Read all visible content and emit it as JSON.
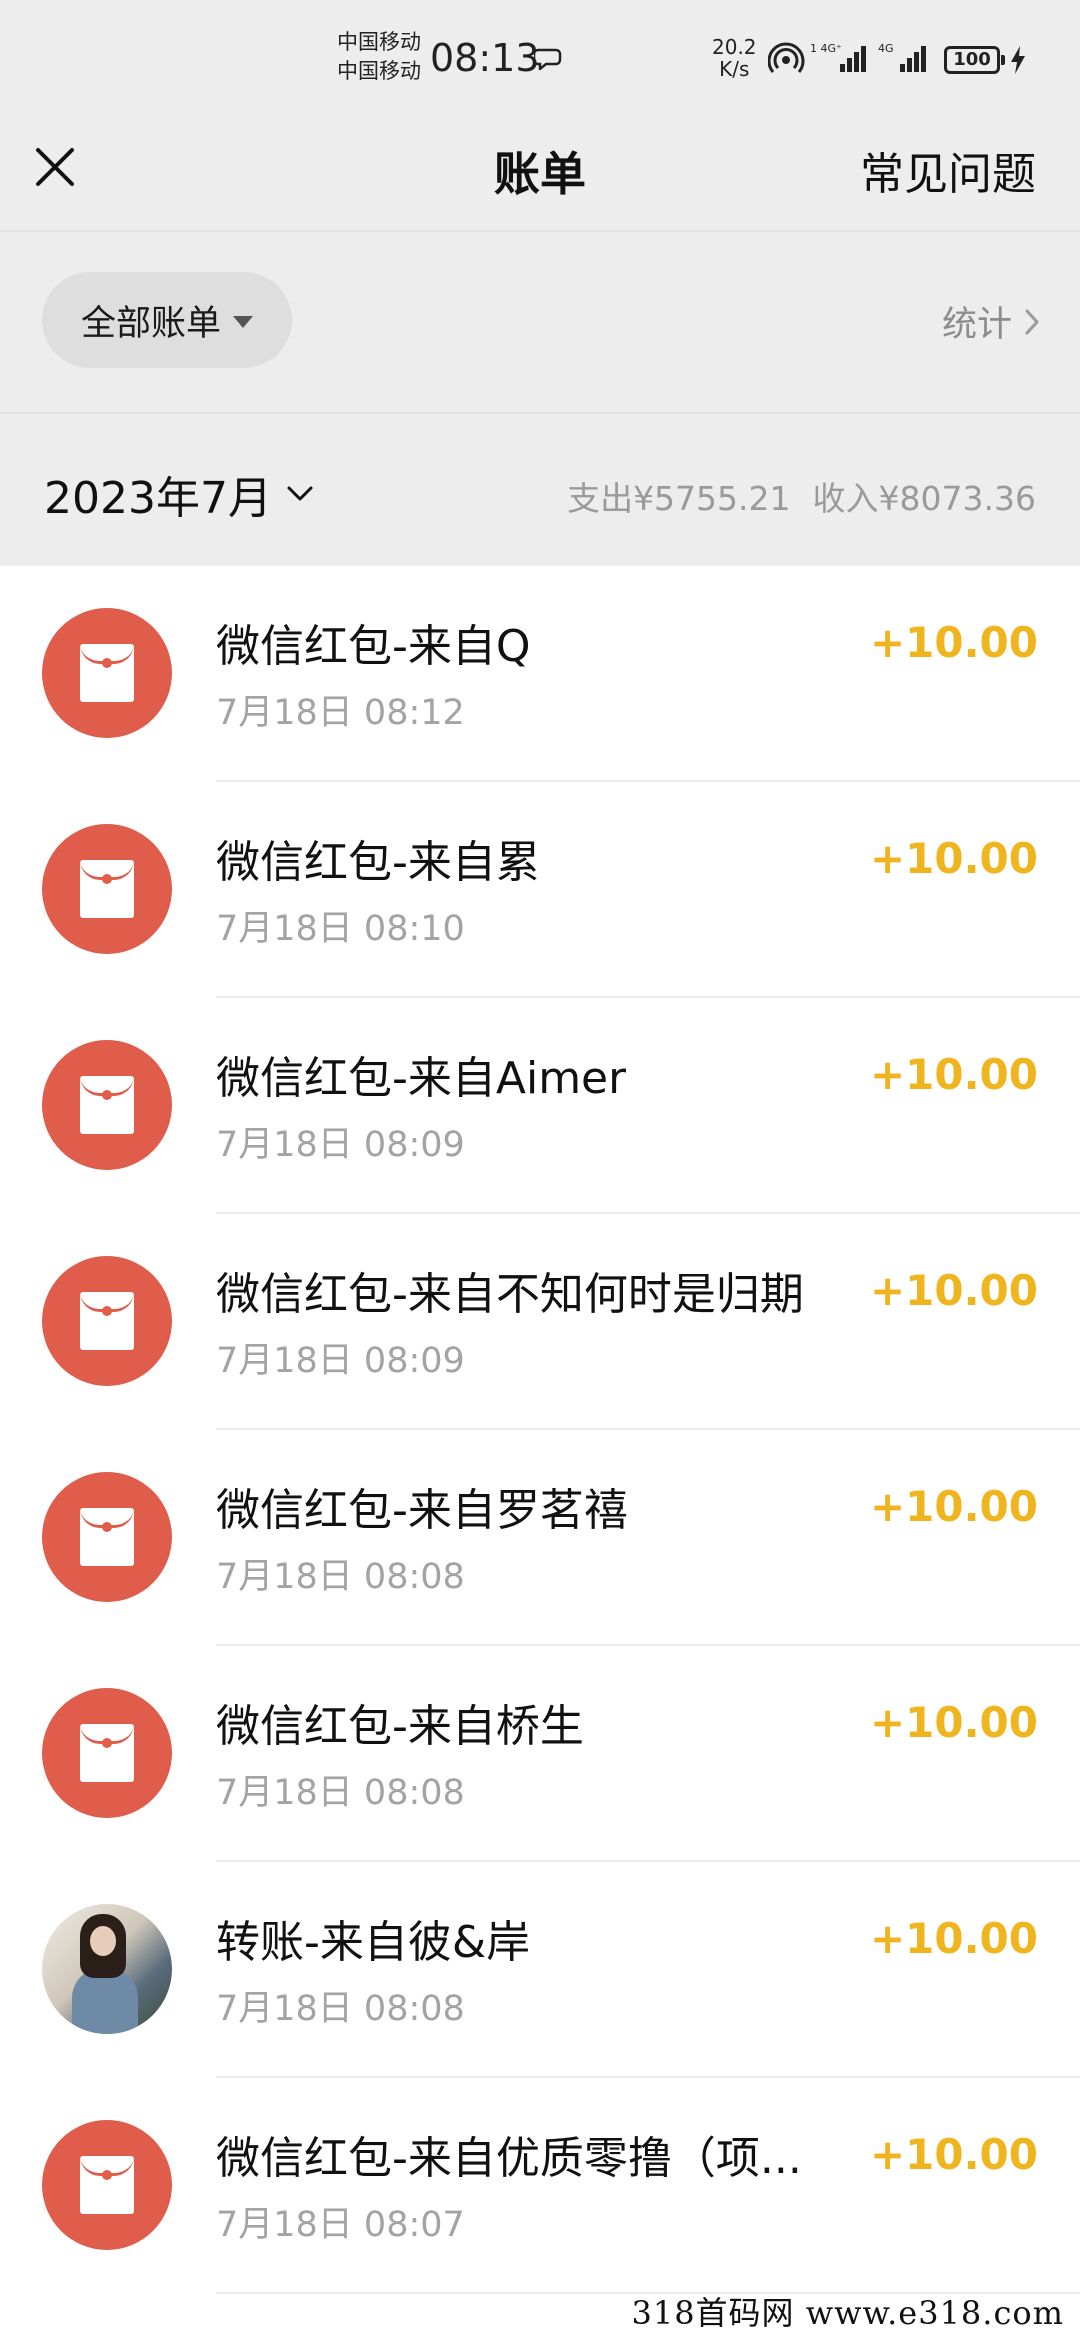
{
  "status_bar": {
    "carrier_1": "中国移动",
    "carrier_2": "中国移动",
    "time": "08:13",
    "speed_value": "20.2",
    "speed_unit": "K/s",
    "battery": "100"
  },
  "header": {
    "title": "账单",
    "faq_label": "常见问题"
  },
  "filter": {
    "selected": "全部账单",
    "stats_label": "统计"
  },
  "month_bar": {
    "month": "2023年7月",
    "expense": "支出¥5755.21",
    "income": "收入¥8073.36"
  },
  "transactions": [
    {
      "title": "微信红包-来自Q",
      "time": "7月18日 08:12",
      "amount": "+10.00",
      "icon": "red-packet-icon"
    },
    {
      "title": "微信红包-来自累",
      "time": "7月18日 08:10",
      "amount": "+10.00",
      "icon": "red-packet-icon"
    },
    {
      "title": "微信红包-来自Aimer",
      "time": "7月18日 08:09",
      "amount": "+10.00",
      "icon": "red-packet-icon"
    },
    {
      "title": "微信红包-来自不知何时是归期",
      "time": "7月18日 08:09",
      "amount": "+10.00",
      "icon": "red-packet-icon"
    },
    {
      "title": "微信红包-来自罗茗禧",
      "time": "7月18日 08:08",
      "amount": "+10.00",
      "icon": "red-packet-icon"
    },
    {
      "title": "微信红包-来自桥生",
      "time": "7月18日 08:08",
      "amount": "+10.00",
      "icon": "red-packet-icon"
    },
    {
      "title": "转账-来自彼&岸",
      "time": "7月18日 08:08",
      "amount": "+10.00",
      "icon": "user-avatar"
    },
    {
      "title": "微信红包-来自优质零撸（项...",
      "time": "7月18日 08:07",
      "amount": "+10.00",
      "icon": "red-packet-icon"
    }
  ],
  "colors": {
    "background": "#ededed",
    "red_packet": "#e05c4b",
    "amount": "#f0b51e"
  },
  "watermark": "318首码网 www.e318.com"
}
